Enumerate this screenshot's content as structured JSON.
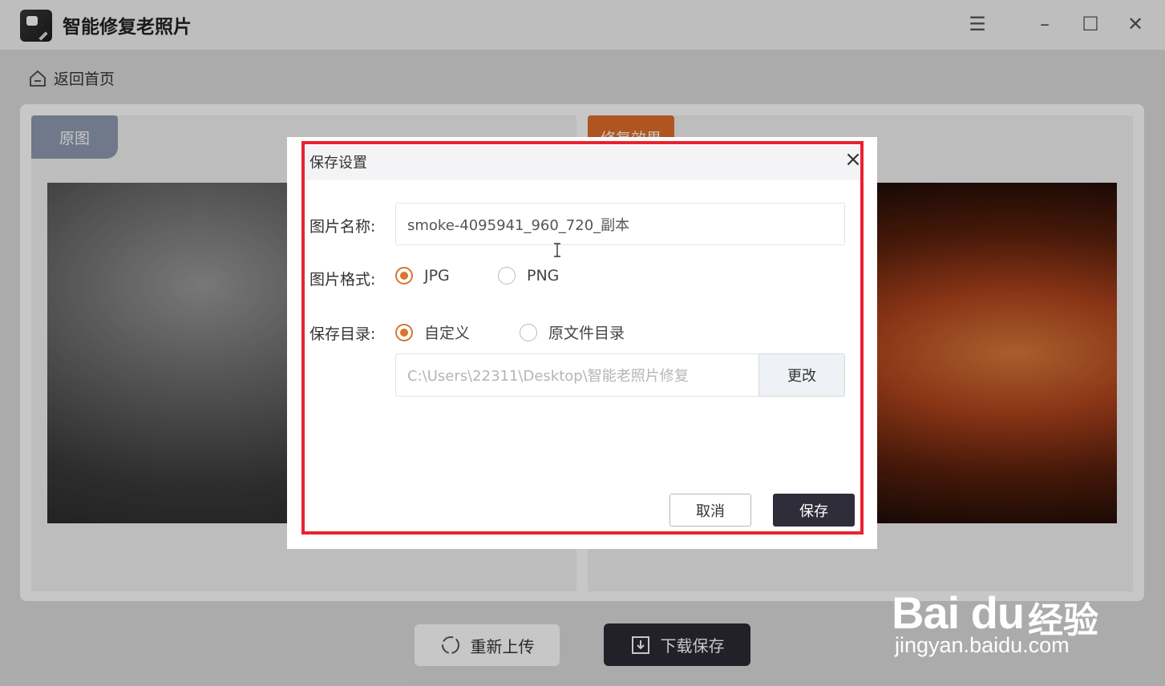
{
  "app": {
    "title": "智能修复老照片"
  },
  "nav": {
    "back_label": "返回首页"
  },
  "tabs": {
    "original_label": "原图",
    "result_label": "修复效果"
  },
  "actions": {
    "reupload_label": "重新上传",
    "download_label": "下载保存"
  },
  "dialog": {
    "title": "保存设置",
    "name_label": "图片名称:",
    "name_value": "smoke-4095941_960_720_副本",
    "format_label": "图片格式:",
    "format_options": [
      "JPG",
      "PNG"
    ],
    "format_selected": "JPG",
    "dir_label": "保存目录:",
    "dir_options": [
      "自定义",
      "原文件目录"
    ],
    "dir_selected": "自定义",
    "dir_path_placeholder": "C:\\Users\\22311\\Desktop\\智能老照片修复",
    "change_label": "更改",
    "cancel_label": "取消",
    "save_label": "保存"
  },
  "watermark": {
    "logo": "Bai du",
    "text": "经验",
    "url": "jingyan.baidu.com"
  },
  "colors": {
    "accent": "#d9752e",
    "highlight": "#e8232f",
    "dark_button": "#2f2d3a"
  }
}
